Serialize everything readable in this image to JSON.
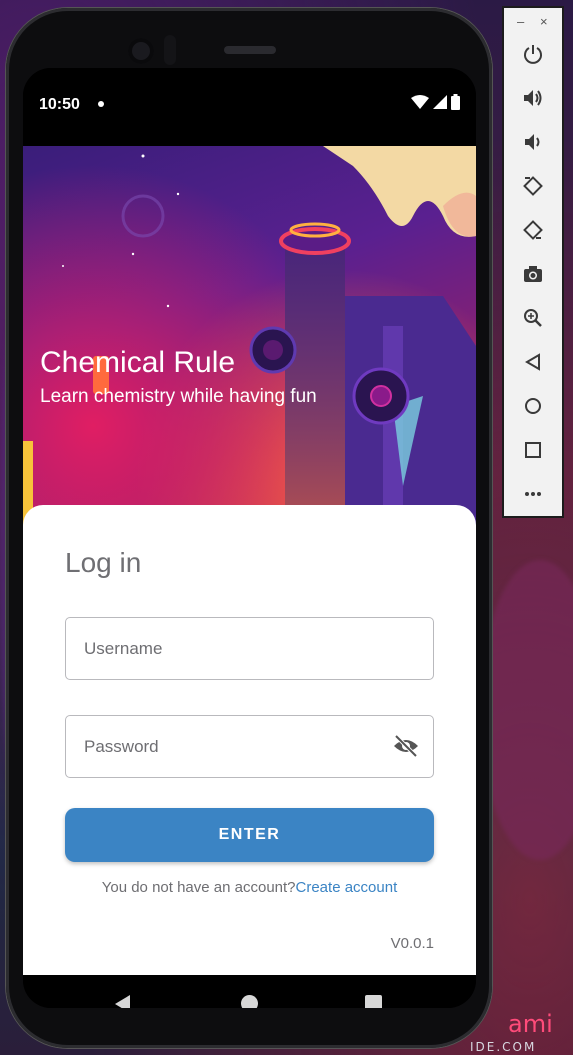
{
  "status_bar": {
    "time": "10:50"
  },
  "hero": {
    "title": "Chemical Rule",
    "subtitle": "Learn chemistry while having fun"
  },
  "login": {
    "title": "Log in",
    "username_placeholder": "Username",
    "password_placeholder": "Password",
    "enter_label": "ENTER",
    "no_account_text": "You do not have an account?",
    "create_account_link": "Create account",
    "version": "V0.0.1"
  },
  "emulator_toolbar": {
    "minimize": "–",
    "close": "×",
    "items": [
      "power-icon",
      "volume-up-icon",
      "volume-down-icon",
      "rotate-left-icon",
      "rotate-right-icon",
      "camera-icon",
      "zoom-icon",
      "back-icon",
      "home-icon",
      "overview-icon",
      "more-icon"
    ]
  },
  "background": {
    "watermark": "ami",
    "watermark2": "IDE.COM"
  },
  "colors": {
    "accent": "#3b84c4",
    "card": "#ffffff",
    "text_muted": "#6e6e72"
  }
}
